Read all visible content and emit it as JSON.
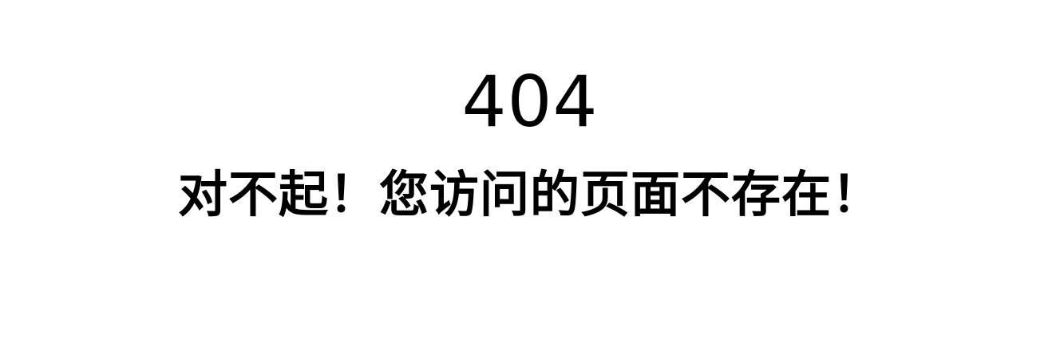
{
  "error": {
    "code": "404",
    "message": "对不起！您访问的页面不存在！"
  }
}
